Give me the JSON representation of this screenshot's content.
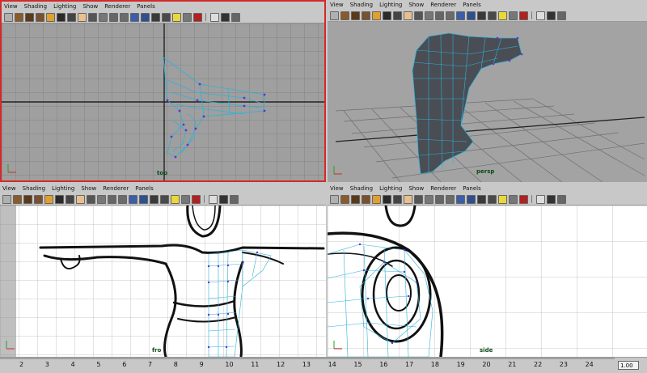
{
  "menu": [
    "View",
    "Shading",
    "Lighting",
    "Show",
    "Renderer",
    "Panels"
  ],
  "panes": {
    "top": {
      "label": "top"
    },
    "persp": {
      "label": "persp"
    },
    "front": {
      "label": "fro"
    },
    "side": {
      "label": "side"
    }
  },
  "timeline": {
    "ticks": [
      "2",
      "3",
      "4",
      "5",
      "6",
      "7",
      "8",
      "9",
      "10",
      "11",
      "12",
      "13",
      "14",
      "15",
      "16",
      "17",
      "18",
      "19",
      "20",
      "21",
      "22",
      "23",
      "24"
    ],
    "current_frame": "1.00"
  },
  "colors": {
    "active_border": "#d42a2a",
    "mesh": "#2bb3d9",
    "vertex": "#6a2bd9",
    "sketch": "#111111",
    "viewport_bg_gray": "#9f9f9f",
    "ortho_bg_white": "#ffffff"
  }
}
